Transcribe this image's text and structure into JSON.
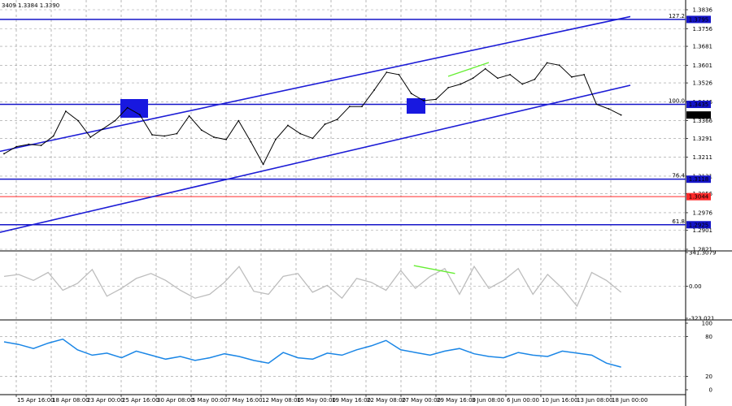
{
  "header": {
    "ohlc_fragment": "3409 1.3384 1.3390"
  },
  "colors": {
    "channel": "#1c1cd6",
    "level": "#1414c8",
    "red_level": "#ff2a2a",
    "price": "#000000",
    "cci": "#bdbdbd",
    "rsi": "#1a86e6",
    "divergence": "#66ee33",
    "box": "#1818e0",
    "grid": "#9a9a9a"
  },
  "chart_data": [
    {
      "type": "line",
      "name": "price",
      "y_ticks": [
        "1.3836",
        "1.3756",
        "1.3681",
        "1.3601",
        "1.3526",
        "1.3446",
        "1.3366",
        "1.3291",
        "1.3211",
        "1.3131",
        "1.3056",
        "1.2976",
        "1.2901",
        "1.2821"
      ],
      "x_ticks": [
        "15 Apr 16:00",
        "18 Apr 08:00",
        "23 Apr 00:00",
        "25 Apr 16:00",
        "30 Apr 08:00",
        "5 May 00:00",
        "7 May 16:00",
        "12 May 08:00",
        "15 May 00:00",
        "19 May 16:00",
        "22 May 08:00",
        "27 May 00:00",
        "29 May 16:00",
        "3 Jun 08:00",
        "6 Jun 00:00",
        "10 Jun 16:00",
        "13 Jun 08:00",
        "18 Jun 00:00"
      ],
      "ylim": [
        1.2821,
        1.3836
      ],
      "current_price": "1.3390",
      "levels": [
        {
          "prefix": "127.2",
          "price": "1.3795",
          "color": "blue"
        },
        {
          "prefix": "100.0",
          "price": "1.3435",
          "color": "blue"
        },
        {
          "prefix": "76.4",
          "price": "1.3118",
          "color": "blue"
        },
        {
          "prefix": "",
          "price": "1.3044",
          "color": "red"
        },
        {
          "prefix": "61.8",
          "price": "1.2925",
          "color": "blue"
        }
      ],
      "channel": {
        "upper": [
          [
            0,
            1.3236
          ],
          [
            1,
            1.3807
          ]
        ],
        "lower": [
          [
            0,
            1.2893
          ],
          [
            1,
            1.3516
          ]
        ]
      },
      "x": [
        0,
        0.02,
        0.04,
        0.06,
        0.08,
        0.1,
        0.12,
        0.14,
        0.16,
        0.18,
        0.2,
        0.22,
        0.24,
        0.26,
        0.28,
        0.3,
        0.32,
        0.34,
        0.36,
        0.38,
        0.4,
        0.42,
        0.44,
        0.46,
        0.48,
        0.5,
        0.52,
        0.54,
        0.56,
        0.58,
        0.6,
        0.62,
        0.64,
        0.66,
        0.68,
        0.7,
        0.72,
        0.74,
        0.76,
        0.78,
        0.8,
        0.82,
        0.84,
        0.86,
        0.88,
        0.9,
        0.92,
        0.94,
        0.96,
        0.98,
        1.0
      ],
      "values": [
        1.3226,
        1.3256,
        1.3266,
        1.3261,
        1.3301,
        1.3406,
        1.3366,
        1.3296,
        1.3331,
        1.3366,
        1.3421,
        1.3391,
        1.3306,
        1.3301,
        1.3311,
        1.3386,
        1.3326,
        1.3296,
        1.3286,
        1.3366,
        1.3276,
        1.3181,
        1.3286,
        1.3346,
        1.3311,
        1.3291,
        1.3351,
        1.3371,
        1.3426,
        1.3426,
        1.3496,
        1.3571,
        1.3561,
        1.3481,
        1.3451,
        1.3456,
        1.3506,
        1.3521,
        1.3546,
        1.3586,
        1.3546,
        1.3561,
        1.3521,
        1.3541,
        1.3611,
        1.3601,
        1.3551,
        1.3561,
        1.3436,
        1.3416,
        1.339
      ]
    },
    {
      "type": "line",
      "name": "CCI",
      "y_ticks": [
        "341.3079",
        "0.00",
        "-323.021"
      ],
      "ylim": [
        -323.021,
        341.3079
      ],
      "divergence": [
        [
          0.607,
          210
        ],
        [
          0.668,
          130
        ]
      ],
      "x": [
        0,
        0.02,
        0.04,
        0.06,
        0.08,
        0.1,
        0.12,
        0.14,
        0.16,
        0.18,
        0.2,
        0.22,
        0.24,
        0.26,
        0.28,
        0.3,
        0.32,
        0.34,
        0.36,
        0.38,
        0.4,
        0.42,
        0.44,
        0.46,
        0.48,
        0.5,
        0.52,
        0.54,
        0.56,
        0.58,
        0.6,
        0.62,
        0.64,
        0.66,
        0.68,
        0.7,
        0.72,
        0.74,
        0.76,
        0.78,
        0.8,
        0.82,
        0.84
      ],
      "values": [
        100,
        120,
        60,
        140,
        -40,
        30,
        170,
        -100,
        -20,
        80,
        130,
        60,
        -40,
        -120,
        -80,
        40,
        200,
        -50,
        -80,
        100,
        130,
        -60,
        10,
        -120,
        80,
        40,
        -40,
        160,
        -20,
        100,
        180,
        -80,
        200,
        -20,
        60,
        180,
        -80,
        120,
        -20,
        -200,
        140,
        60,
        -60
      ]
    },
    {
      "type": "line",
      "name": "RSI",
      "y_ticks": [
        "100",
        "80",
        "20",
        "0"
      ],
      "ylim": [
        0,
        100
      ],
      "x": [
        0,
        0.02,
        0.04,
        0.06,
        0.08,
        0.1,
        0.12,
        0.14,
        0.16,
        0.18,
        0.2,
        0.22,
        0.24,
        0.26,
        0.28,
        0.3,
        0.32,
        0.34,
        0.36,
        0.38,
        0.4,
        0.42,
        0.44,
        0.46,
        0.48,
        0.5,
        0.52,
        0.54,
        0.56,
        0.58,
        0.6,
        0.62,
        0.64,
        0.66,
        0.68,
        0.7,
        0.72,
        0.74,
        0.76,
        0.78,
        0.8,
        0.82,
        0.84
      ],
      "values": [
        72,
        68,
        62,
        70,
        76,
        60,
        52,
        55,
        48,
        58,
        52,
        46,
        50,
        44,
        48,
        54,
        50,
        44,
        40,
        56,
        48,
        46,
        55,
        52,
        60,
        66,
        74,
        60,
        56,
        52,
        58,
        62,
        54,
        50,
        48,
        56,
        52,
        50,
        58,
        55,
        52,
        40,
        34
      ]
    }
  ]
}
